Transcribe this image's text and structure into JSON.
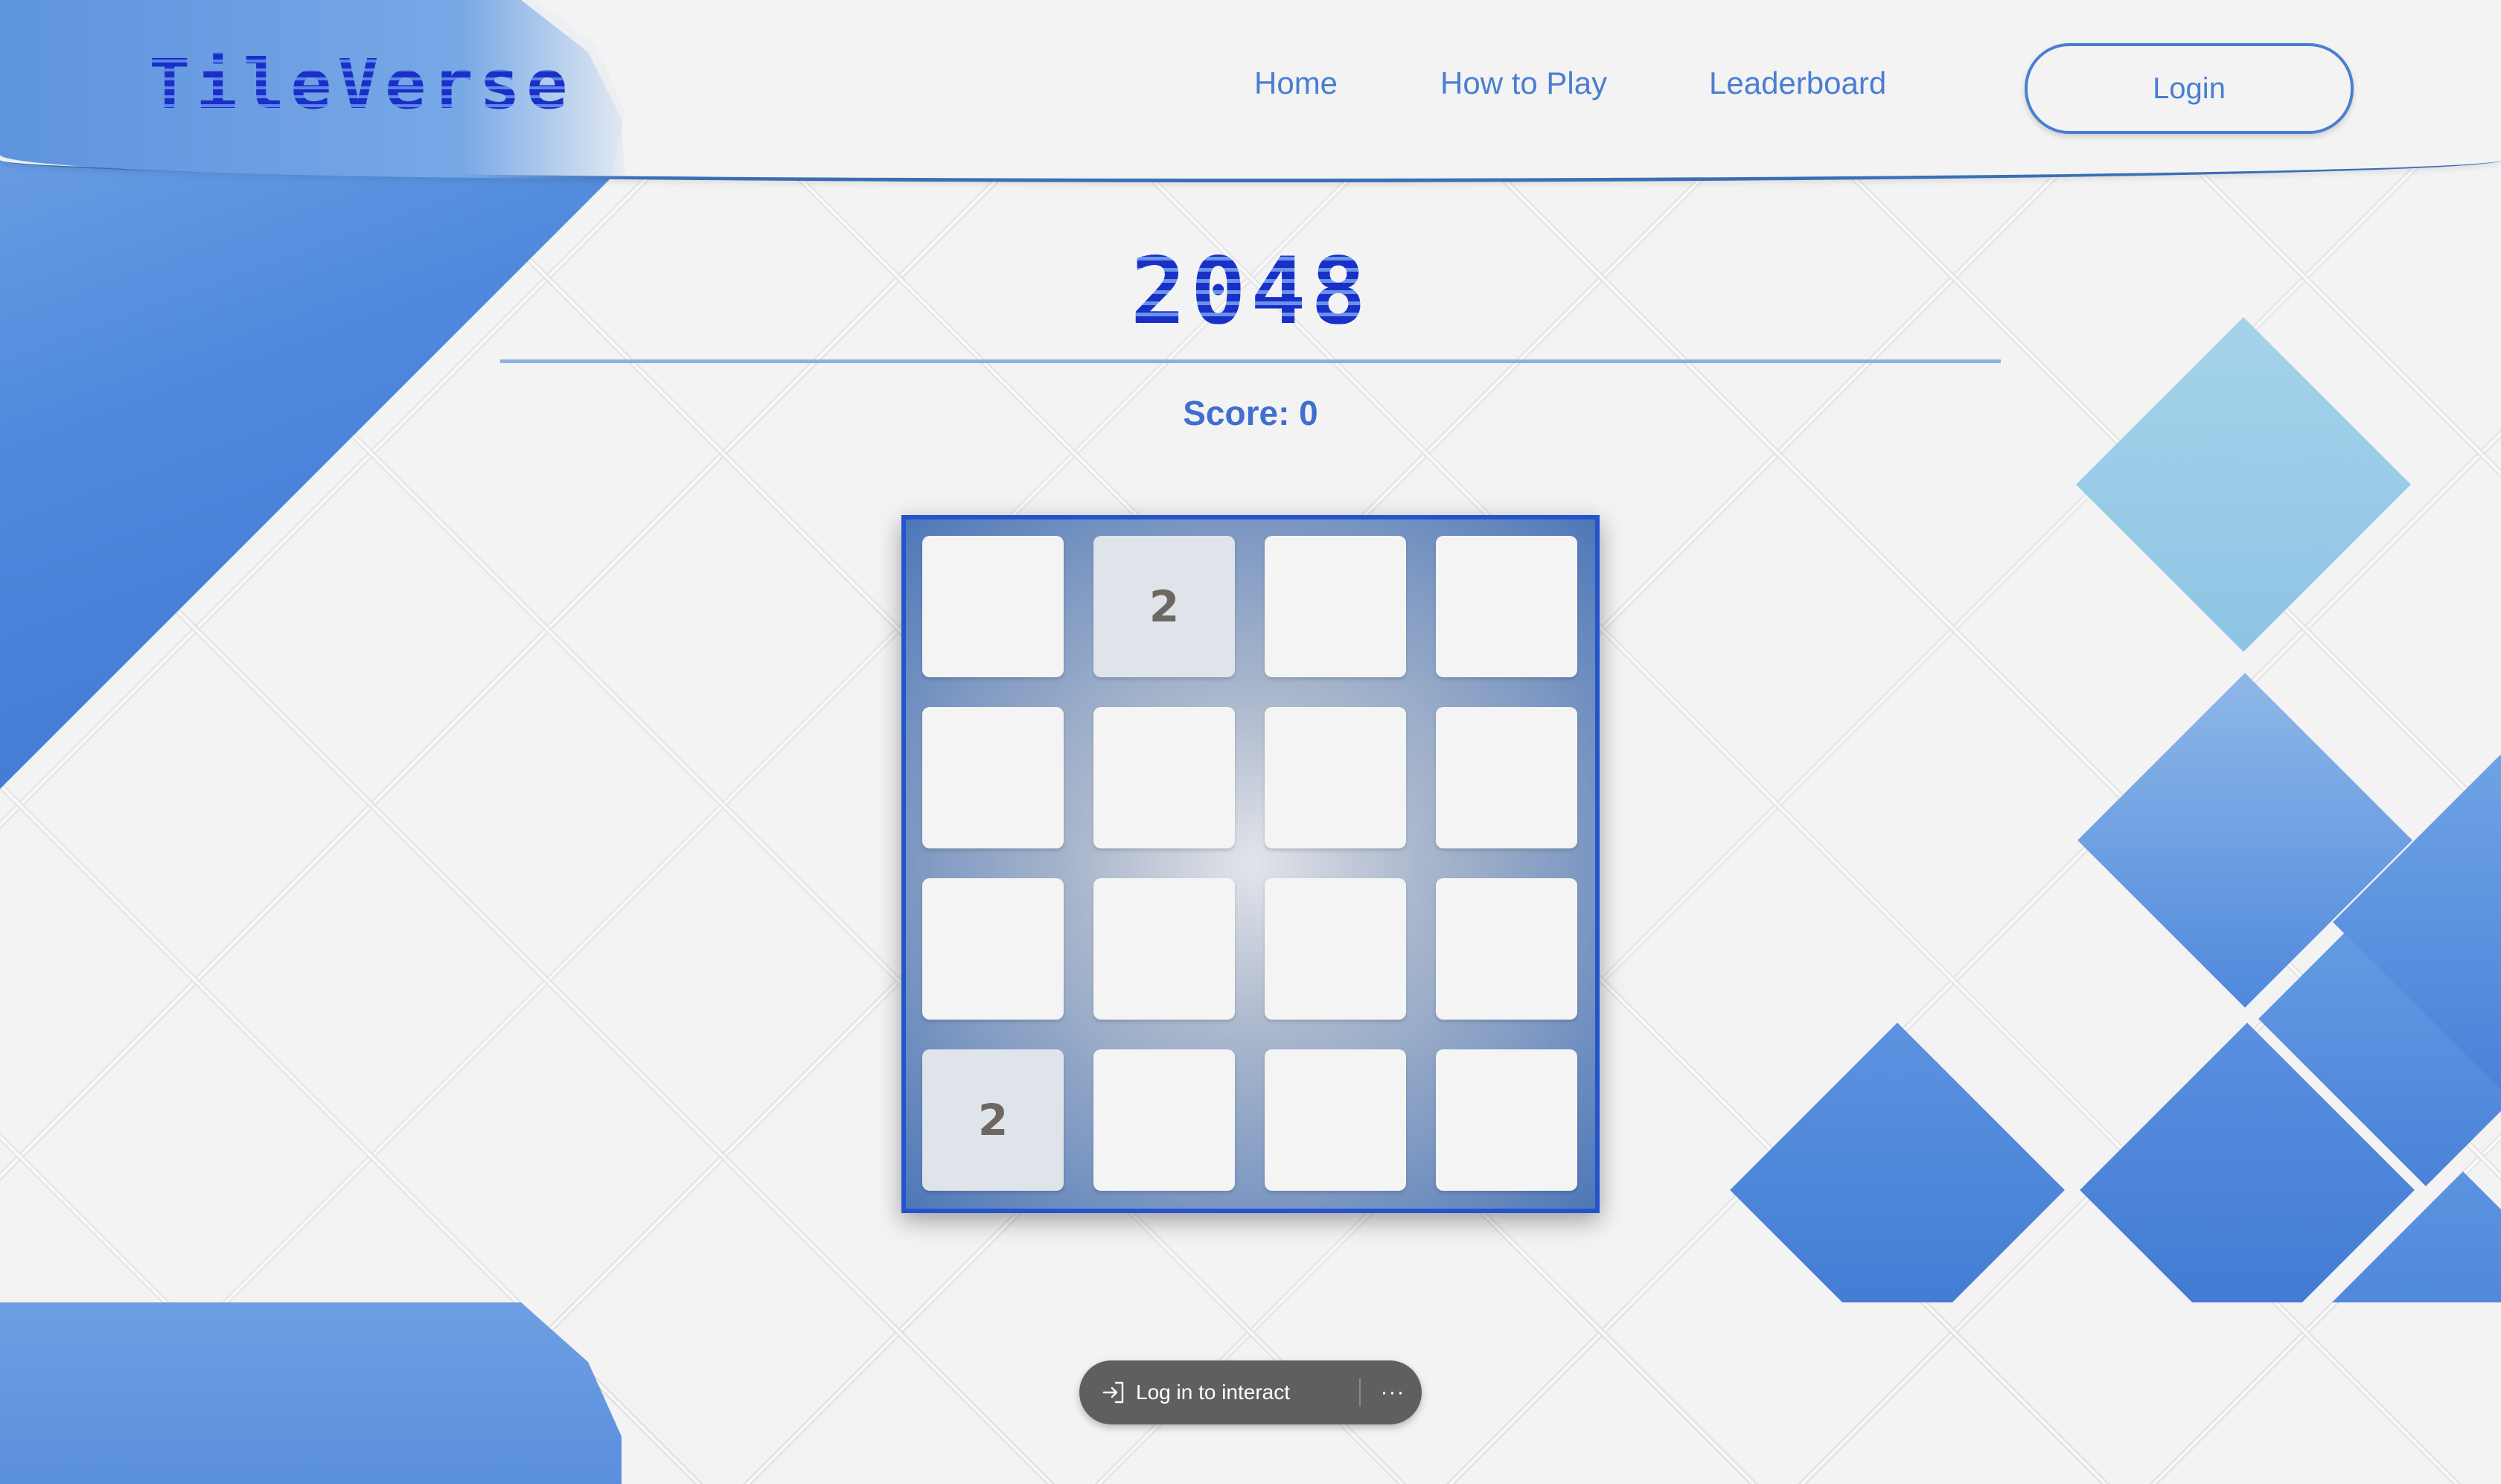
{
  "header": {
    "logo_text": "TileVerse",
    "nav": [
      {
        "label": "Home"
      },
      {
        "label": "How to Play"
      },
      {
        "label": "Leaderboard"
      }
    ],
    "login_label": "Login"
  },
  "game": {
    "title": "2048",
    "score_label": "Score:",
    "score_value": "0",
    "grid": [
      [
        "",
        "2",
        "",
        ""
      ],
      [
        "",
        "",
        "",
        ""
      ],
      [
        "",
        "",
        "",
        ""
      ],
      [
        "2",
        "",
        "",
        ""
      ]
    ]
  },
  "toast": {
    "text": "Log in to interact",
    "icon": "login-arrow-icon",
    "more_icon": "more-dots-icon",
    "more_label": "···"
  },
  "colors": {
    "accent": "#4a7ed0",
    "board_border": "#2454cc",
    "tile_empty": "#f4f4f4",
    "tile_two": "#dfe4ea",
    "tile_text": "#6e6862"
  }
}
